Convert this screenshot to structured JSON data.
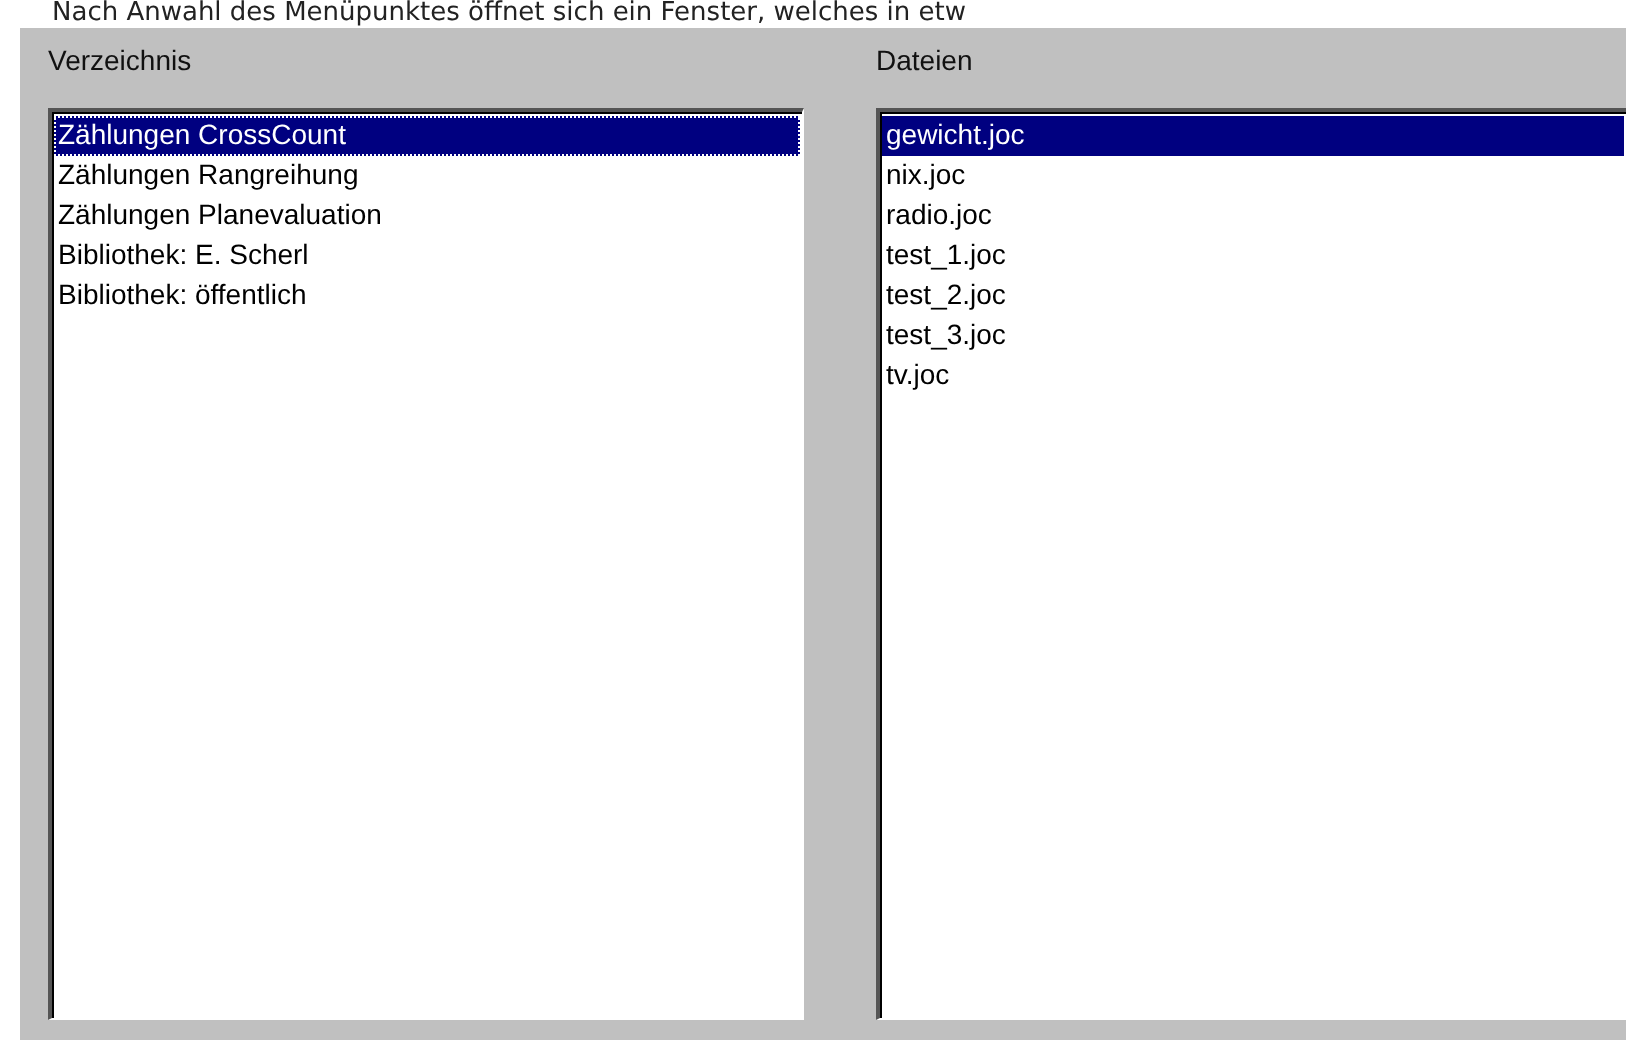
{
  "caption": "Nach Anwahl des Menüpunktes öffnet sich ein Fenster, welches in etw",
  "panels": [
    {
      "label": "Verzeichnis",
      "focused": true,
      "items": [
        {
          "text": "Zählungen CrossCount",
          "selected": true
        },
        {
          "text": "Zählungen Rangreihung",
          "selected": false
        },
        {
          "text": "Zählungen Planevaluation",
          "selected": false
        },
        {
          "text": "Bibliothek: E. Scherl",
          "selected": false
        },
        {
          "text": "Bibliothek: öffentlich",
          "selected": false
        }
      ]
    },
    {
      "label": "Dateien",
      "focused": false,
      "items": [
        {
          "text": "gewicht.joc",
          "selected": true
        },
        {
          "text": "nix.joc",
          "selected": false
        },
        {
          "text": "radio.joc",
          "selected": false
        },
        {
          "text": "test_1.joc",
          "selected": false
        },
        {
          "text": "test_2.joc",
          "selected": false
        },
        {
          "text": "test_3.joc",
          "selected": false
        },
        {
          "text": "tv.joc",
          "selected": false
        }
      ]
    }
  ]
}
